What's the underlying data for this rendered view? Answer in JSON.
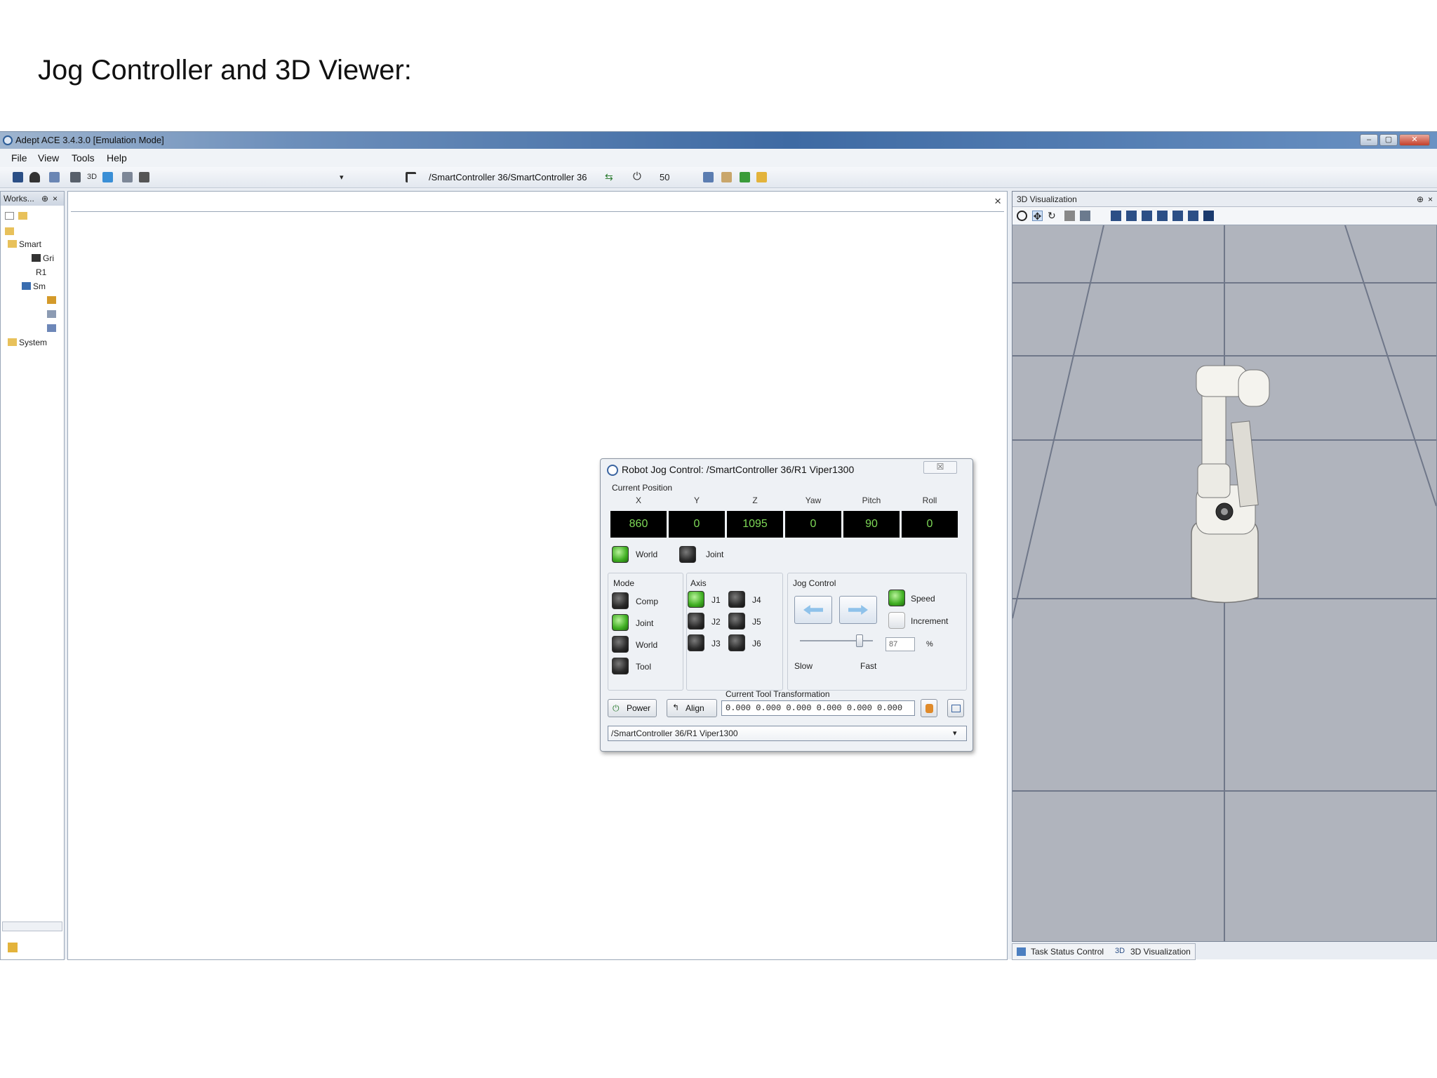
{
  "slide": {
    "title": "Jog Controller and 3D Viewer:"
  },
  "window": {
    "title": "Adept ACE 3.4.3.0 [Emulation Mode]",
    "min": "–",
    "max": "▢",
    "close": "✕"
  },
  "menu": {
    "items": [
      "File",
      "View",
      "Tools",
      "Help"
    ]
  },
  "toolbar": {
    "path": "/SmartController 36/SmartController 36",
    "speed": "50",
    "three_d": "3D"
  },
  "workspace": {
    "header": "Works...",
    "pin": "⊕",
    "close": "×",
    "tree": [
      "Smart",
      "Gri",
      "R1",
      "Sm",
      "System"
    ]
  },
  "document": {
    "close": "×"
  },
  "jog": {
    "title": "Robot Jog Control: /SmartController 36/R1 Viper1300",
    "close": "☒",
    "current_position_label": "Current Position",
    "axes": [
      "X",
      "Y",
      "Z",
      "Yaw",
      "Pitch",
      "Roll"
    ],
    "values": [
      "860",
      "0",
      "1095",
      "0",
      "90",
      "0"
    ],
    "frame": {
      "world": "World",
      "joint": "Joint"
    },
    "mode": {
      "label": "Mode",
      "items": [
        "Comp",
        "Joint",
        "World",
        "Tool"
      ]
    },
    "axis": {
      "label": "Axis",
      "items": [
        "J1",
        "J2",
        "J3",
        "J4",
        "J5",
        "J6"
      ]
    },
    "jog_control": {
      "label": "Jog Control",
      "speed": "Speed",
      "increment": "Increment",
      "slow": "Slow",
      "fast": "Fast",
      "speed_value": "87",
      "unit": "%"
    },
    "tool": {
      "label": "Current Tool Transformation",
      "value": "0.000 0.000 0.000 0.000 0.000 0.000"
    },
    "buttons": {
      "power": "Power",
      "align": "Align"
    },
    "robot_select": "/SmartController 36/R1 Viper1300"
  },
  "viz": {
    "header": "3D Visualization",
    "pin": "⊕",
    "close": "×"
  },
  "bottom_tabs": {
    "task": "Task Status Control",
    "viz": "3D Visualization",
    "viz_prefix": "3D"
  },
  "colors": {
    "led_on": "#3fae22",
    "lcd_text": "#7ed957",
    "floor": "#b0b4bd"
  }
}
